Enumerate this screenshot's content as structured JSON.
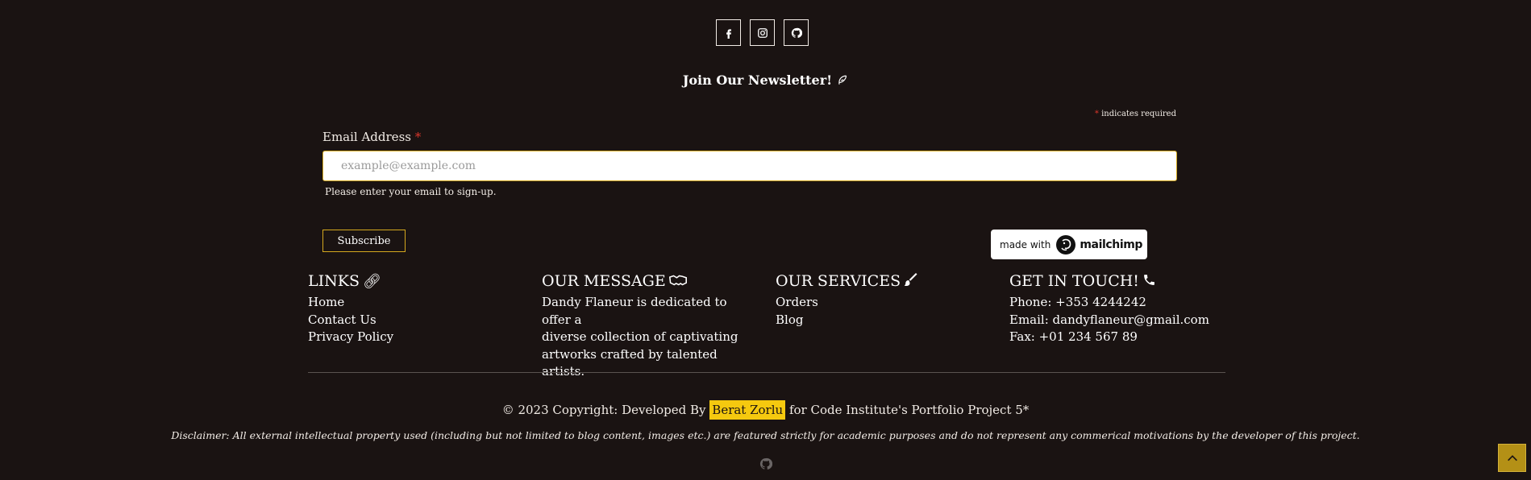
{
  "social": {
    "items": [
      {
        "icon": "facebook-icon"
      },
      {
        "icon": "instagram-icon"
      },
      {
        "icon": "github-icon"
      }
    ]
  },
  "newsletter": {
    "title": "Join Our Newsletter!",
    "title_icon": "feather-icon",
    "required_asterisk": "*",
    "required_note": "indicates required",
    "email_label": "Email Address",
    "email_placeholder": "example@example.com",
    "email_value": "",
    "help_text": "Please enter your email to sign-up.",
    "subscribe_label": "Subscribe",
    "mailchimp_prefix": "made with",
    "mailchimp_brand": "mailchimp"
  },
  "footer": {
    "links": {
      "heading": "LINKS",
      "icon": "link-icon",
      "items": [
        "Home",
        "Contact Us",
        "Privacy Policy"
      ]
    },
    "message": {
      "heading": "OUR MESSAGE",
      "icon": "handshake-icon",
      "lines": [
        "Dandy Flaneur is dedicated to offer a",
        "diverse collection of captivating",
        "artworks crafted by talented artists."
      ]
    },
    "services": {
      "heading": "OUR SERVICES",
      "icon": "paintbrush-icon",
      "items": [
        "Orders",
        "Blog"
      ]
    },
    "contact": {
      "heading": "GET IN TOUCH!",
      "icon": "phone-icon",
      "phone": "Phone: +353 4244242",
      "email": "Email: dandyflaneur@gmail.com",
      "fax": "Fax: +01 234 567 89"
    }
  },
  "copyright": {
    "prefix": "© 2023 Copyright: Developed By",
    "author": "Berat Zorlu",
    "suffix": "for Code Institute's Portfolio Project 5*"
  },
  "disclaimer": "Disclaimer: All external intellectual property used (including but not limited to blog content, images etc.) are featured strictly for academic purposes and do not represent any commerical motivations by the developer of this project.",
  "colors": {
    "background": "#1a1312",
    "accent": "#d4a81e",
    "highlight": "#f5c90f",
    "required": "#d9362b"
  }
}
